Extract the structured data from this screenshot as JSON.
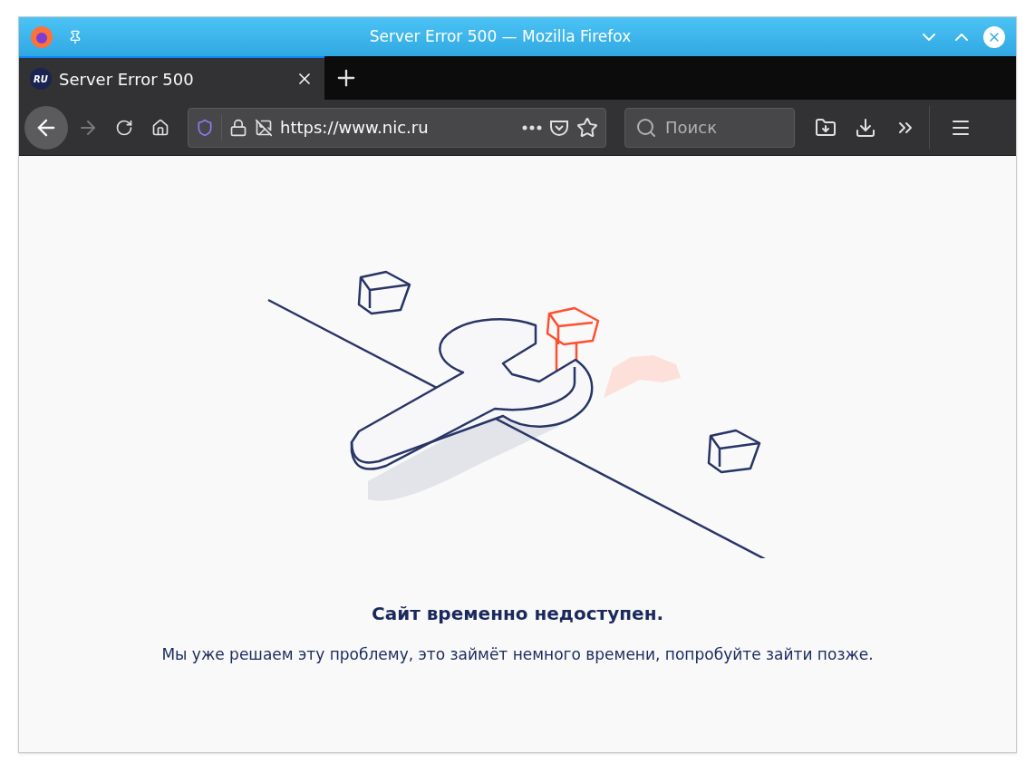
{
  "window": {
    "title": "Server Error 500 — Mozilla Firefox"
  },
  "tabs": [
    {
      "favicon": "RU",
      "label": "Server Error 500",
      "selected": true
    }
  ],
  "toolbar": {
    "url": "https://www.nic.ru",
    "search_placeholder": "Поиск",
    "forward_disabled": true
  },
  "page": {
    "heading": "Сайт временно недоступен.",
    "message": "Мы уже решаем эту проблему, это займёт немного времени, попробуйте зайти позже."
  }
}
